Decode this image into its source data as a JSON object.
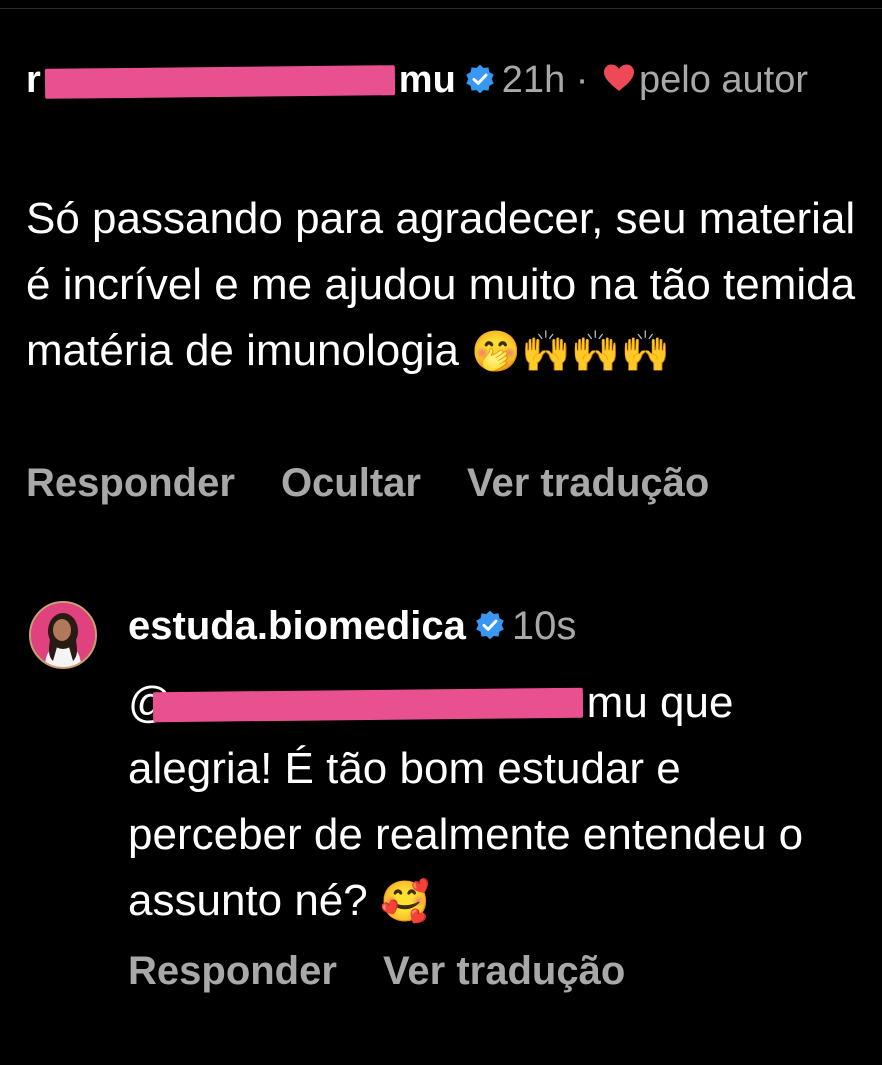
{
  "comment": {
    "username_prefix": "r",
    "username_suffix": "mu",
    "time": "21h",
    "separator": "·",
    "liked_by_label": "pelo autor",
    "text": "Só passando para agradecer, seu material é incrível e me ajudou muito na tão temida matéria de imunologia",
    "emojis": "🤭🙌🙌🙌",
    "actions": {
      "reply": "Responder",
      "hide": "Ocultar",
      "translate": "Ver tradução"
    }
  },
  "reply": {
    "username": "estuda.biomedica",
    "time": "10s",
    "mention_prefix": "@",
    "mention_suffix": "mu",
    "text": "que alegria! É tão bom estudar e perceber de realmente entendeu o assunto né?",
    "emoji": "🥰",
    "actions": {
      "reply": "Responder",
      "translate": "Ver tradução"
    }
  },
  "colors": {
    "background": "#000000",
    "primary_text": "#ffffff",
    "secondary_text": "#a8a8a8",
    "verified_blue": "#3897f0",
    "heart_red": "#ed4956",
    "redaction_pink": "#e8508f"
  },
  "icons": {
    "verified": "verified-badge-icon",
    "heart": "heart-icon"
  }
}
